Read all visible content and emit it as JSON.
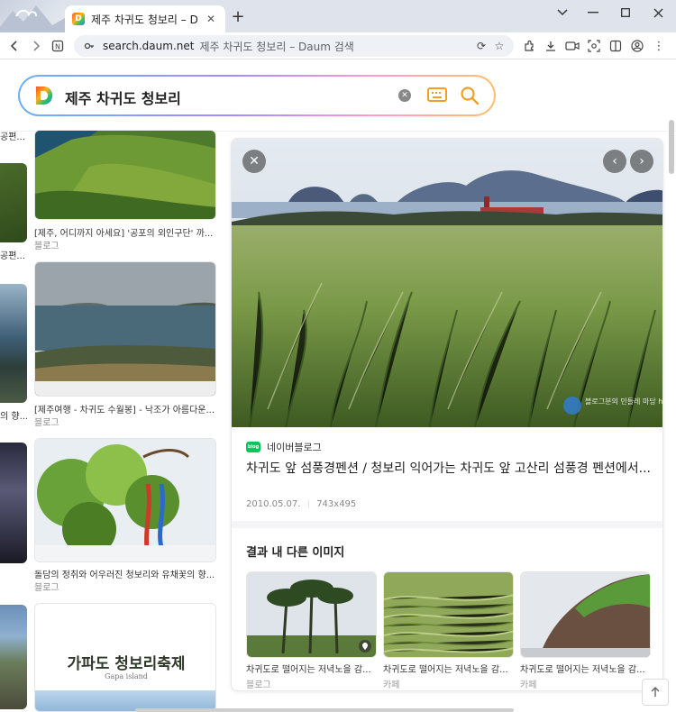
{
  "browser": {
    "tab_title": "제주 차귀도 청보리 – Daum 검색",
    "url_host": "search.daum.net",
    "url_title": "제주 차귀도 청보리 – Daum 검색"
  },
  "search": {
    "query": "제주 차귀도 청보리"
  },
  "left_strip": {
    "captions": [
      "공편...",
      "공편...",
      "의 향...",
      ""
    ]
  },
  "results": [
    {
      "caption": "[제주, 어디까지 아세요] '공포의 외인구단' 까...",
      "source": "블로그"
    },
    {
      "caption": "[제주여행 - 차귀도 수월봉] - 낙조가 아름다운...",
      "source": "블로그"
    },
    {
      "caption": "돌담의 정취와 어우러진 청보리와 유채꽃의 향...",
      "source": "블로그"
    },
    {
      "caption": "가파도 청보리축제",
      "subcaption": "Gapa island",
      "source": ""
    }
  ],
  "detail": {
    "source_badge": "blog",
    "source_name": "네이버블로그",
    "title": "차귀도 앞 섬풍경펜션 / 청보리 익어가는 차귀도 앞 고산리 섬풍경 펜션에서...",
    "date": "2010.05.07.",
    "size": "743x495",
    "watermark": "블로그분의 민들레 마당  http://www.xxxx.com",
    "more_heading": "결과 내 다른 이미지",
    "more": [
      {
        "caption": "차귀도로 떨어지는 저녁노을 감...",
        "source": "블로그"
      },
      {
        "caption": "차귀도로 떨어지는 저녁노을 감...",
        "source": "카페"
      },
      {
        "caption": "차귀도로 떨어지는 저녁노을 감...",
        "source": "카페"
      }
    ]
  },
  "icons": {
    "close": "close-icon",
    "prev": "chevron-left-icon",
    "next": "chevron-right-icon",
    "to_top": "arrow-up-icon"
  }
}
